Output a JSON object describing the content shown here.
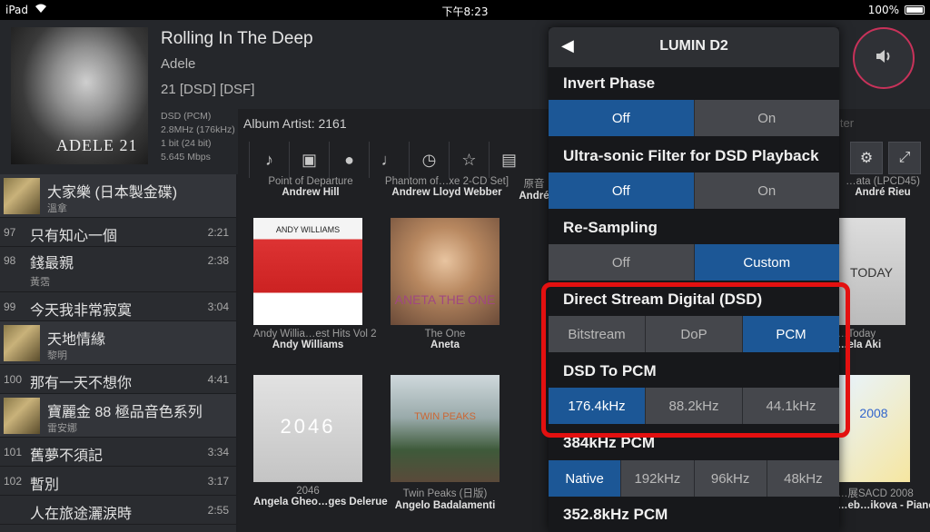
{
  "status": {
    "device": "iPad",
    "time": "下午8:23",
    "battery": "100%"
  },
  "now_playing": {
    "cover_text": "ADELE 21",
    "title": "Rolling In The Deep",
    "artist": "Adele",
    "album": "21 [DSD] [DSF]",
    "tech": [
      "DSD (PCM)",
      "2.8MHz (176kHz)",
      "1 bit (24 bit)",
      "5.645 Mbps"
    ]
  },
  "tracks": [
    {
      "kind": "album",
      "title": "大家樂 (日本製金碟)",
      "sub": "溫拿"
    },
    {
      "kind": "track",
      "num": "97",
      "title": "只有知心一個",
      "dur": "2:21"
    },
    {
      "kind": "track",
      "num": "98",
      "title": "錢最親",
      "sub": "黃霑",
      "dur": "2:38"
    },
    {
      "kind": "track",
      "num": "99",
      "title": "今天我非常寂寞",
      "dur": "3:04"
    },
    {
      "kind": "album",
      "title": "天地情緣",
      "sub": "黎明"
    },
    {
      "kind": "track",
      "num": "100",
      "title": "那有一天不想你",
      "dur": "4:41"
    },
    {
      "kind": "album",
      "title": "寶麗金 88 極品音色系列",
      "sub": "雷安娜"
    },
    {
      "kind": "track",
      "num": "101",
      "title": "舊夢不須記",
      "dur": "3:34"
    },
    {
      "kind": "track",
      "num": "102",
      "title": "暫別",
      "dur": "3:17"
    },
    {
      "kind": "track",
      "num": "",
      "title": "人在旅途灑淚時",
      "dur": "2:55"
    }
  ],
  "browser": {
    "album_artist_label": "Album Artist: 2161",
    "filter_text": "lter",
    "top_row": [
      {
        "a": "Point of Departure",
        "b": "Andrew Hill"
      },
      {
        "a": "Phantom of…xe 2-CD Set]",
        "b": "Andrew Lloyd Webber"
      },
      {
        "a": "原音",
        "b": "André"
      },
      {
        "a": "…ata (LPCD45)",
        "b": "André Rieu"
      }
    ],
    "tiles": [
      {
        "a": "Andy Willia…est Hits Vol 2",
        "b": "Andy Williams",
        "art": "ANDY WILLIAMS"
      },
      {
        "a": "The One",
        "b": "Aneta",
        "art": "ANETA THE ONE"
      },
      {
        "a": "…Today",
        "b": "…ela Aki",
        "art": "TODAY"
      },
      {
        "a": "2046",
        "b": "Angela Gheo…ges Delerue",
        "art": "2046"
      },
      {
        "a": "Twin Peaks (日版)",
        "b": "Angelo Badalamenti",
        "art": "TWIN PEAKS"
      },
      {
        "a": "…展SACD 2008",
        "b": "…eb…ikova - Piano",
        "art": "2008"
      }
    ]
  },
  "panel": {
    "title": "LUMIN D2",
    "sections": [
      {
        "label": "Invert Phase",
        "options": [
          "Off",
          "On"
        ],
        "selected": 0
      },
      {
        "label": "Ultra-sonic Filter for DSD Playback",
        "options": [
          "Off",
          "On"
        ],
        "selected": 0
      },
      {
        "label": "Re-Sampling",
        "options": [
          "Off",
          "Custom"
        ],
        "selected": 1
      },
      {
        "label": "Direct Stream Digital (DSD)",
        "options": [
          "Bitstream",
          "DoP",
          "PCM"
        ],
        "selected": 2
      },
      {
        "label": "DSD To PCM",
        "options": [
          "176.4kHz",
          "88.2kHz",
          "44.1kHz"
        ],
        "selected": 0
      },
      {
        "label": "384kHz PCM",
        "options": [
          "Native",
          "192kHz",
          "96kHz",
          "48kHz"
        ],
        "selected": 0
      },
      {
        "label": "352.8kHz PCM",
        "options": [],
        "selected": -1
      }
    ]
  },
  "colors": {
    "selected": "#1c5796",
    "highlight": "#e31010",
    "volume_ring": "#c8325a"
  }
}
